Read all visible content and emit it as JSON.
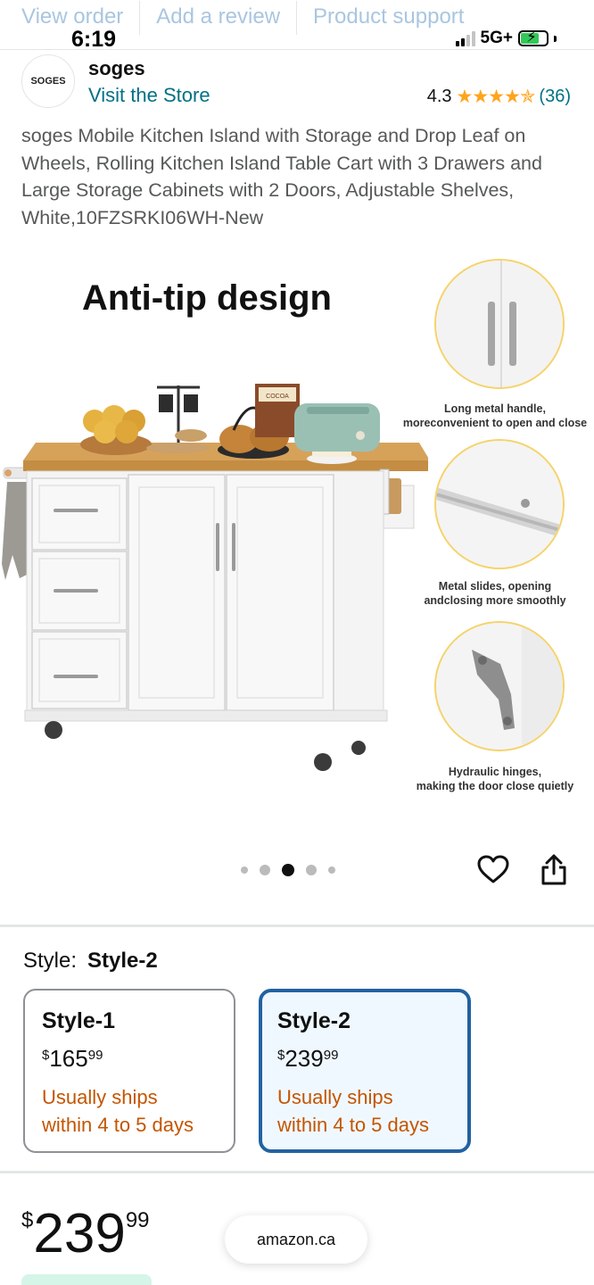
{
  "top_nav": [
    "View order",
    "Add a review",
    "Product support"
  ],
  "status_bar": {
    "time": "6:19",
    "network": "5G+",
    "battery_charging": true
  },
  "brand": {
    "logo_text": "SOGES",
    "name": "soges",
    "visit_store": "Visit the Store"
  },
  "rating": {
    "value": "4.3",
    "stars": 4.3,
    "count": "(36)"
  },
  "product_title": "soges Mobile Kitchen Island with Storage and Drop Leaf on Wheels, Rolling Kitchen Island Table Cart with 3 Drawers and Large Storage Cabinets with 2 Doors, Adjustable Shelves, White,10FZSRKI06WH-New",
  "image": {
    "headline": "Anti-tip design",
    "features": [
      {
        "caption_line1": "Long metal handle,",
        "caption_line2": "moreconvenient to open and close"
      },
      {
        "caption_line1": "Metal slides, opening",
        "caption_line2": "andclosing more smoothly"
      },
      {
        "caption_line1": "Hydraulic hinges,",
        "caption_line2": "making the door close quietly"
      }
    ],
    "box_label": "COCOA"
  },
  "carousel": {
    "count": 5,
    "active_index": 2
  },
  "style": {
    "label": "Style:",
    "selected": "Style-2",
    "options": [
      {
        "name": "Style-1",
        "currency": "$",
        "whole": "165",
        "cents": "99",
        "ship_line1": "Usually ships",
        "ship_line2": "within 4 to 5 days",
        "selected": false
      },
      {
        "name": "Style-2",
        "currency": "$",
        "whole": "239",
        "cents": "99",
        "ship_line1": "Usually ships",
        "ship_line2": "within 4 to 5 days",
        "selected": true
      }
    ]
  },
  "price": {
    "currency": "$",
    "whole": "239",
    "cents": "99"
  },
  "url_pill": "amazon.ca",
  "colors": {
    "link": "#007185",
    "star": "#ffa41c",
    "shipping": "#c45500",
    "selected_border": "#2162a1",
    "selected_bg": "#f0f8ff"
  }
}
